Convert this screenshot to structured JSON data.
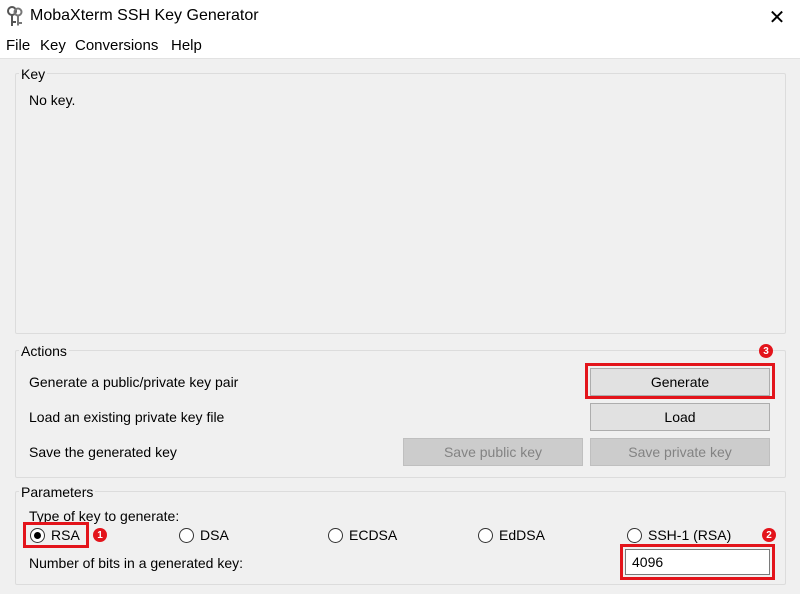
{
  "window": {
    "title": "MobaXterm SSH Key Generator",
    "close_glyph": "✕"
  },
  "menu": {
    "items": [
      "File",
      "Key",
      "Conversions",
      "Help"
    ]
  },
  "key_group": {
    "label": "Key",
    "content": "No key."
  },
  "actions": {
    "label": "Actions",
    "generate_text": "Generate a public/private key pair",
    "generate_button": "Generate",
    "load_text": "Load an existing private key file",
    "load_button": "Load",
    "save_text": "Save the generated key",
    "save_public_button": "Save public key",
    "save_private_button": "Save private key"
  },
  "parameters": {
    "label": "Parameters",
    "type_label": "Type of key to generate:",
    "key_types": [
      "RSA",
      "DSA",
      "ECDSA",
      "EdDSA",
      "SSH-1 (RSA)"
    ],
    "selected_type": "RSA",
    "bits_label": "Number of bits in a generated key:",
    "bits_value": "4096"
  },
  "annotations": {
    "badge_1": "1",
    "badge_2": "2",
    "badge_3": "3",
    "color": "#e3141b"
  }
}
